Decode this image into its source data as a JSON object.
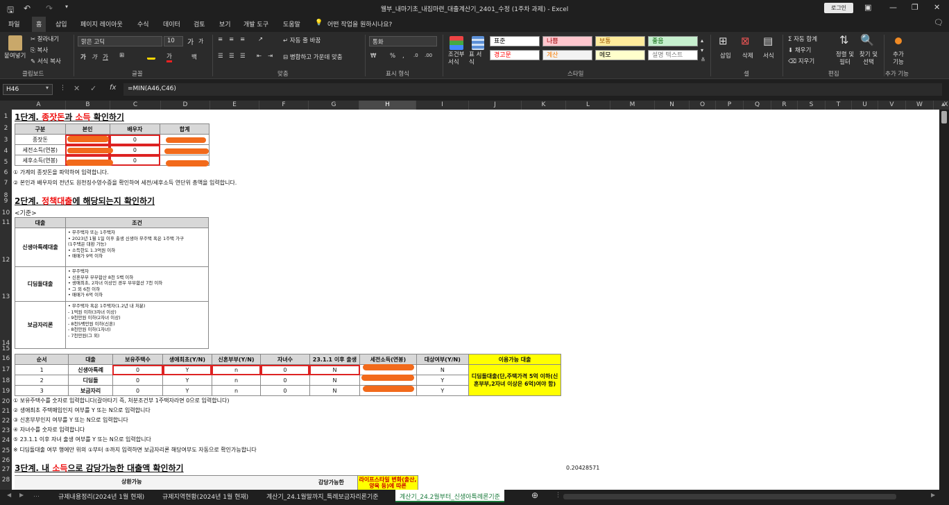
{
  "window": {
    "title": "웰부_내마기초_내집마련_대출계산기_2401_수정 (1주차 과제)  -  Excel",
    "login": "로그인"
  },
  "menu": [
    "파일",
    "홈",
    "삽입",
    "페이지 레이아웃",
    "수식",
    "데이터",
    "검토",
    "보기",
    "개발 도구",
    "도움말"
  ],
  "tell_me": "어떤 작업을 원하시나요?",
  "ribbon": {
    "paste": "붙여넣기",
    "cut": "잘라내기",
    "copy": "복사",
    "format_painter": "서식 복사",
    "clipboard": "클립보드",
    "font_name": "맑은 고딕",
    "font_size": "10",
    "font_group": "글꼴",
    "wrap": "자동 줄 바꿈",
    "merge": "병합하고 가운데 맞춤",
    "align_group": "맞춤",
    "num_format": "통화",
    "num_group": "표시 형식",
    "cond_format": "조건부 서식",
    "table_format": "표 서식",
    "styles": [
      {
        "label": "표준",
        "bg": "#ffffff",
        "fg": "#000000"
      },
      {
        "label": "나쁨",
        "bg": "#ffc7ce",
        "fg": "#9c0006"
      },
      {
        "label": "보통",
        "bg": "#ffeb9c",
        "fg": "#9c5700"
      },
      {
        "label": "좋음",
        "bg": "#c6efce",
        "fg": "#006100"
      },
      {
        "label": "경고문",
        "bg": "#ffffff",
        "fg": "#ff0000"
      },
      {
        "label": "계산",
        "bg": "#f2f2f2",
        "fg": "#fa7d00"
      },
      {
        "label": "메모",
        "bg": "#ffffcc",
        "fg": "#000000"
      },
      {
        "label": "설명 텍스트",
        "bg": "#ffffff",
        "fg": "#7f7f7f"
      }
    ],
    "style_group": "스타일",
    "insert": "삽입",
    "delete": "삭제",
    "format": "서식",
    "cells_group": "셀",
    "autosum": "자동 합계",
    "fill": "채우기",
    "clear": "지우기",
    "sort_filter": "정렬 및 필터",
    "find_select": "찾기 및 선택",
    "edit_group": "편집",
    "addins": "추가 기능",
    "addins_group": "추가 기능"
  },
  "formula_bar": {
    "cell": "H46",
    "formula": "=MIN(A46,C46)"
  },
  "columns": [
    "A",
    "B",
    "C",
    "D",
    "E",
    "F",
    "G",
    "H",
    "I",
    "J",
    "K",
    "L",
    "M",
    "N",
    "O",
    "P",
    "Q",
    "R",
    "S",
    "T",
    "U",
    "V",
    "W",
    "X"
  ],
  "rows": [
    "1",
    "2",
    "3",
    "4",
    "5",
    "6",
    "7",
    "8",
    "9",
    "10",
    "11",
    "12",
    "13",
    "14",
    "15",
    "16",
    "17",
    "18",
    "19",
    "20",
    "21",
    "22",
    "23",
    "24",
    "25",
    "26",
    "27",
    "28"
  ],
  "step1": {
    "pre": "1단계. ",
    "h1": "종잣돈",
    "mid": "과 ",
    "h2": "소득",
    "post": " 확인하기",
    "headers": [
      "구분",
      "본인",
      "배우자",
      "합계"
    ],
    "rows": [
      [
        "종잣돈",
        "0"
      ],
      [
        "세전소득(연봉)",
        "0"
      ],
      [
        "세후소득(연봉)",
        "0"
      ]
    ],
    "notes": [
      "① 가계의 종잣돈을 파악하여 입력합니다.",
      "② 본인과 배우자의 전년도 원천징수영수증을 확인하여 세전/세후소득 연단위 총액을 입력합니다."
    ]
  },
  "step2": {
    "pre": "2단계. ",
    "h1": "정책대출",
    "post": "에 해당되는지 확인하기",
    "criteria": "<기준>",
    "headers": [
      "대출",
      "조건"
    ],
    "loans": [
      {
        "name": "신생아특례대출",
        "cond": [
          "• 무주택자 또는 1주택자",
          "• 2023년 1월 1일 이후 출생 신생아 무주택 혹은 1주택 가구",
          "  (1주택은 대환 가능)",
          "• 소득한도 1.3억원 이하",
          "• 매매가 9억 이하"
        ]
      },
      {
        "name": "디딤돌대출",
        "cond": [
          "• 무주택자",
          "• 신혼부부 부부합산 8천 5백 이하",
          "• 생애최초, 2자녀 이상인 경우 부부합산 7천 이하",
          "• 그 외 6천 이하",
          "• 매매가 6억 이하"
        ]
      },
      {
        "name": "보금자리론",
        "cond": [
          "• 무주택자 혹은 1주택자(1.2년 내 처분)",
          "  - 1억원 이하(3자녀 이상)",
          "  - 9천만원 이하(2자녀 이상)",
          "  - 8천5백만원 이하(신혼)",
          "  - 8천만원 이하(1자녀)",
          "  - 7천만원(그 외)"
        ]
      }
    ],
    "table_headers": [
      "순서",
      "대출",
      "보유주택수",
      "생애최초(Y/N)",
      "신혼부부(Y/N)",
      "자녀수",
      "23.1.1 이후 출생",
      "세전소득(연봉)",
      "대상여부(Y/N)",
      "이용가능 대출"
    ],
    "table_rows": [
      [
        "1",
        "신생아특례",
        "0",
        "Y",
        "n",
        "0",
        "N",
        "N"
      ],
      [
        "2",
        "디딤돌",
        "0",
        "Y",
        "n",
        "0",
        "N",
        "Y"
      ],
      [
        "3",
        "보금자리",
        "0",
        "Y",
        "n",
        "0",
        "N",
        "Y"
      ]
    ],
    "available": "디딤돌대출(단,주택가격 5억 이하(신혼부부,2자녀 이상은 6억)여야 함)",
    "notes": [
      "① 보유주택수를 숫자로 입력합니다(갈아타기 즉, 처분조건부 1주택자라면 0으로 입력합니다)",
      "② 생애최초 주택매입인지 여부를 Y 또는 N으로 입력합니다",
      "③ 신혼부부인지 여부를 Y 또는 N으로 입력합니다",
      "④ 자녀수를 숫자로 입력합니다",
      "⑤ 23.1.1 이후 자녀 출생 여부를 Y 또는 N으로 입력합니다",
      "※ 디딤돌대출 여부 행에만 위의 ①부터 ⑤까지 입력하면 보금자리론 해당여부도 자동으로 확인가능합니다"
    ]
  },
  "step3": {
    "pre": "3단계. 내 ",
    "h1": "소득",
    "post": "으로 감당가능한 대출액 확인하기",
    "value": "0.20428571",
    "h_repay": "상환가능",
    "h_afford": "감당가능한",
    "h_life": "라이프스타일 변화(출산, 양육 등)에 따른"
  },
  "sheet_tabs": [
    "규제내용정리(2024년 1월 현재)",
    "규제지역현황(2024년 1월 현재)",
    "계산기_24.1월말까지_특례보금자리론기준",
    "계산기_24.2월부터_신생아특례론기준"
  ]
}
